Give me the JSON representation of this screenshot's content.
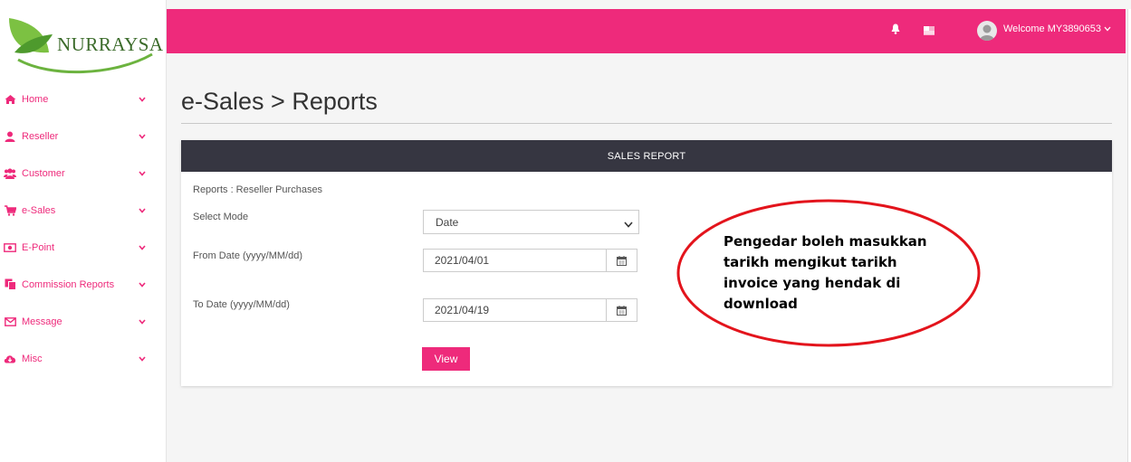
{
  "brand": {
    "name": "NURRAYSA",
    "trademark": "®"
  },
  "colors": {
    "accent": "#ee2a7b",
    "header_dark": "#363641",
    "annotation": "#e3141c"
  },
  "sidebar": {
    "items": [
      {
        "label": "Home",
        "icon": "home-icon"
      },
      {
        "label": "Reseller",
        "icon": "user-icon"
      },
      {
        "label": "Customer",
        "icon": "users-icon"
      },
      {
        "label": "e-Sales",
        "icon": "cart-icon"
      },
      {
        "label": "E-Point",
        "icon": "money-icon"
      },
      {
        "label": "Commission Reports",
        "icon": "copy-icon"
      },
      {
        "label": "Message",
        "icon": "envelope-icon"
      },
      {
        "label": "Misc",
        "icon": "cloud-download-icon"
      }
    ]
  },
  "topbar": {
    "welcome": "Welcome MY3890653"
  },
  "page": {
    "title": "e-Sales > Reports"
  },
  "report": {
    "header": "SALES REPORT",
    "breadcrumb": "Reports : Reseller Purchases",
    "select_mode_label": "Select Mode",
    "select_mode_value": "Date",
    "from_label": "From Date (yyyy/MM/dd)",
    "from_value": "2021/04/01",
    "to_label": "To Date (yyyy/MM/dd)",
    "to_value": "2021/04/19",
    "view_button": "View"
  },
  "annotation": {
    "lines": [
      "Pengedar boleh masukkan",
      "tarikh mengikut tarikh",
      "invoice yang hendak di",
      "download"
    ]
  }
}
